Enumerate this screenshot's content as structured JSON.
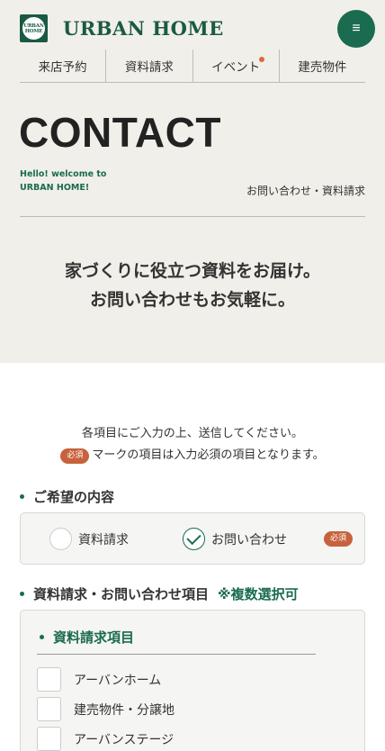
{
  "header": {
    "logo_mark_lines": [
      "URBAN",
      "HOME"
    ],
    "logo_text": "URBAN HOME",
    "menu_icon": "≡"
  },
  "nav": {
    "items": [
      {
        "label": "来店予約",
        "dot": false
      },
      {
        "label": "資料請求",
        "dot": false
      },
      {
        "label": "イベント",
        "dot": true
      },
      {
        "label": "建売物件",
        "dot": false
      }
    ]
  },
  "hero": {
    "title": "CONTACT",
    "hello_line1": "Hello! welcome to",
    "hello_line2": "URBAN HOME!",
    "subtitle": "お問い合わせ・資料請求",
    "catch_line1": "家づくりに役立つ資料をお届け。",
    "catch_line2": "お問い合わせもお気軽に。"
  },
  "intro": {
    "line1": "各項目にご入力の上、送信してください。",
    "badge": "必須",
    "line2": "マークの項目は入力必須の項目となります。"
  },
  "section1": {
    "title": "ご希望の内容",
    "options": [
      {
        "label": "資料請求",
        "checked": false
      },
      {
        "label": "お問い合わせ",
        "checked": true
      }
    ],
    "required_badge": "必須"
  },
  "section2": {
    "title": "資料請求・お問い合わせ項目",
    "note": "※複数選択可",
    "group_title": "資料請求項目",
    "items": [
      "アーバンホーム",
      "建売物件・分譲地",
      "アーバンステージ"
    ]
  },
  "colors": {
    "brand_green": "#1a5a44",
    "accent_orange": "#c7623c",
    "hero_bg": "#f1efe9"
  }
}
